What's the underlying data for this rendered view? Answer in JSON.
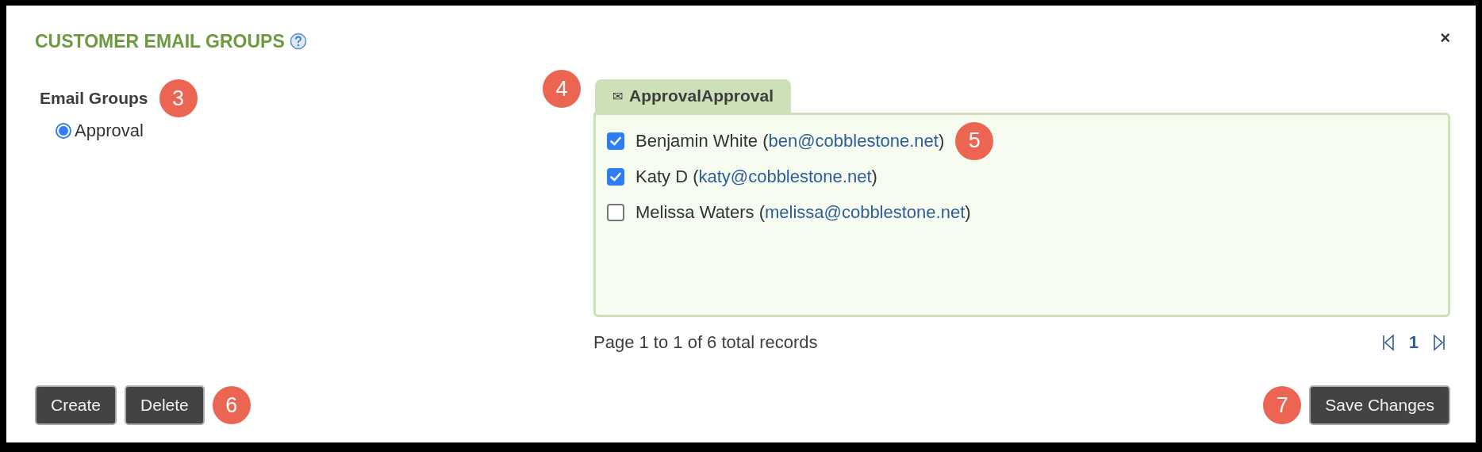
{
  "dialog": {
    "title": "CUSTOMER EMAIL GROUPS",
    "close": "×"
  },
  "email_groups": {
    "heading": "Email Groups",
    "badge": "3",
    "options": [
      {
        "label": "Approval",
        "selected": true
      }
    ]
  },
  "recipients": {
    "tab": {
      "icon": "✉",
      "label": "ApprovalApproval",
      "badge": "4"
    },
    "rows": [
      {
        "name": "Benjamin White",
        "open_paren": "(",
        "email": "ben@cobblestone.net",
        "close_paren": ")",
        "checked": true,
        "badge": "5"
      },
      {
        "name": "Katy D",
        "open_paren": "(",
        "email": "katy@cobblestone.net",
        "close_paren": ")",
        "checked": true
      },
      {
        "name": "Melissa Waters",
        "open_paren": "(",
        "email": "melissa@cobblestone.net",
        "close_paren": ")",
        "checked": false
      }
    ],
    "pager": {
      "summary": "Page 1 to 1 of 6 total records",
      "pages": [
        {
          "label": "1",
          "selected": true
        }
      ]
    }
  },
  "left_actions": {
    "buttons": [
      "Create",
      "Delete"
    ],
    "badge": "6"
  },
  "right_actions": {
    "buttons": [
      "Save Changes"
    ],
    "badge": "7"
  }
}
